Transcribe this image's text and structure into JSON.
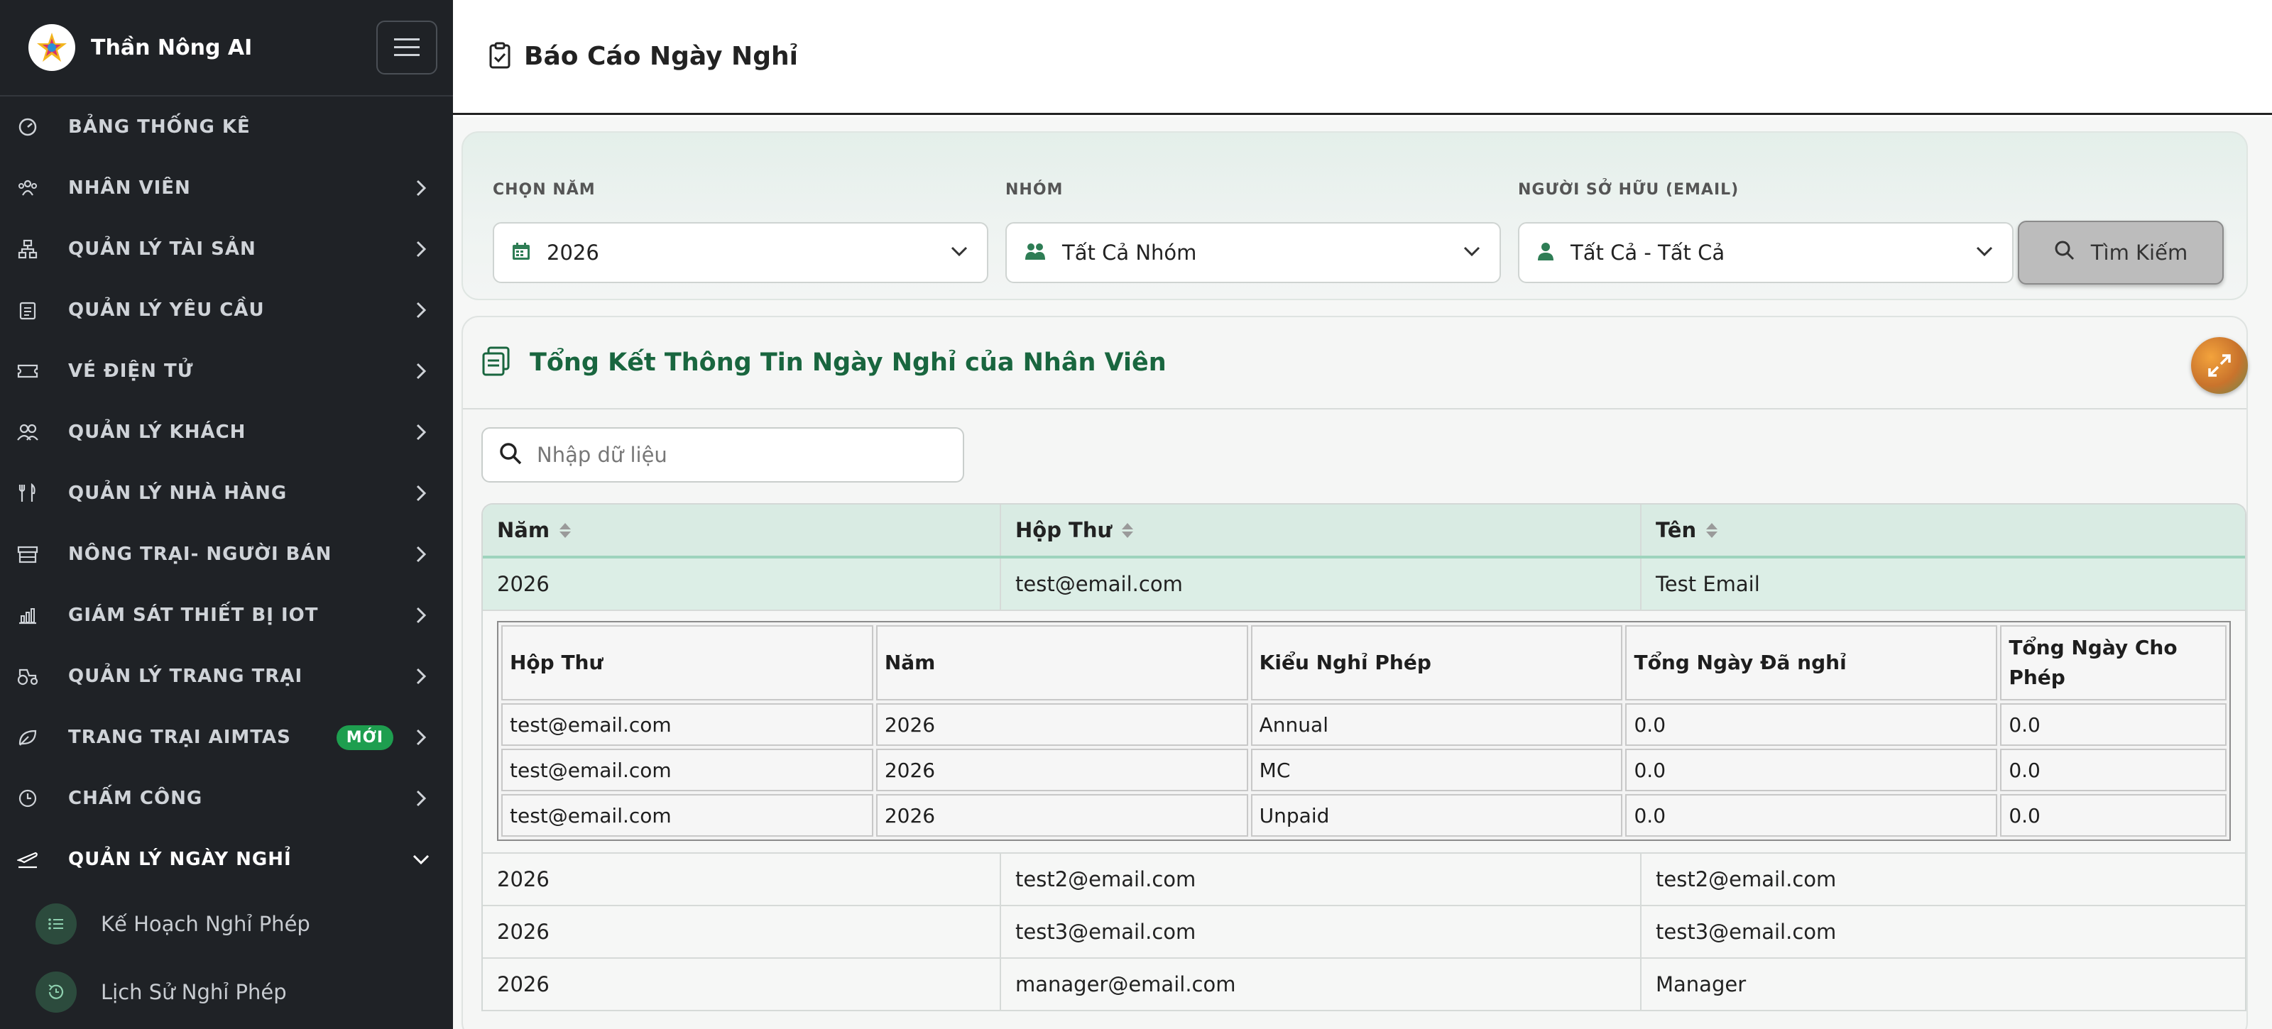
{
  "app": {
    "brand_name": "Thần Nông AI"
  },
  "sidebar": {
    "items": [
      {
        "key": "dashboard",
        "label": "BẢNG THỐNG KÊ",
        "icon": "gauge-icon",
        "chevron": false
      },
      {
        "key": "employees",
        "label": "NHÂN VIÊN",
        "icon": "people-icon",
        "chevron": true
      },
      {
        "key": "assets",
        "label": "QUẢN LÝ TÀI SẢN",
        "icon": "sitemap-icon",
        "chevron": true
      },
      {
        "key": "requests",
        "label": "QUẢN LÝ YÊU CẦU",
        "icon": "clipboard-icon",
        "chevron": true
      },
      {
        "key": "tickets",
        "label": "VÉ ĐIỆN TỬ",
        "icon": "ticket-icon",
        "chevron": true
      },
      {
        "key": "customers",
        "label": "QUẢN LÝ KHÁCH",
        "icon": "users-icon",
        "chevron": true
      },
      {
        "key": "restaurant",
        "label": "QUẢN LÝ NHÀ HÀNG",
        "icon": "utensils-icon",
        "chevron": true
      },
      {
        "key": "farm-sellers",
        "label": "NÔNG TRẠI- NGƯỜI BÁN",
        "icon": "store-icon",
        "chevron": true
      },
      {
        "key": "iot",
        "label": "GIÁM SÁT THIẾT BỊ IOT",
        "icon": "chart-icon",
        "chevron": true
      },
      {
        "key": "farm",
        "label": "QUẢN LÝ TRANG TRẠI",
        "icon": "tractor-icon",
        "chevron": true
      },
      {
        "key": "aimtas",
        "label": "TRANG TRẠI AIMTAS",
        "icon": "leaf-icon",
        "chevron": true,
        "badge": "MỚI"
      },
      {
        "key": "timekeeping",
        "label": "CHẤM CÔNG",
        "icon": "clock-icon",
        "chevron": true
      },
      {
        "key": "leave",
        "label": "QUẢN LÝ NGÀY NGHỈ",
        "icon": "plane-icon",
        "chevron": true,
        "open": true
      }
    ],
    "sub_items": [
      {
        "label": "Kế Hoạch Nghỉ Phép",
        "icon": "list-icon"
      },
      {
        "label": "Lịch Sử Nghỉ Phép",
        "icon": "history-icon"
      }
    ]
  },
  "header": {
    "title": "Báo Cáo Ngày Nghỉ"
  },
  "filters": {
    "year_label": "CHỌN NĂM",
    "year_value": "2026",
    "group_label": "NHÓM",
    "group_value": "Tất Cả Nhóm",
    "owner_label": "NGƯỜI SỞ HỮU (EMAIL)",
    "owner_value": "Tất Cả - Tất Cả",
    "search_button": "Tìm Kiếm"
  },
  "summary": {
    "title": "Tổng Kết Thông Tin Ngày Nghỉ của Nhân Viên",
    "search_placeholder": "Nhập dữ liệu",
    "columns": [
      "Năm",
      "Hộp Thư",
      "Tên"
    ],
    "rows": [
      {
        "year": "2026",
        "email": "test@email.com",
        "name": "Test Email"
      },
      {
        "year": "2026",
        "email": "test2@email.com",
        "name": "test2@email.com"
      },
      {
        "year": "2026",
        "email": "test3@email.com",
        "name": "test3@email.com"
      },
      {
        "year": "2026",
        "email": "manager@email.com",
        "name": "Manager"
      }
    ],
    "detail": {
      "columns": [
        "Hộp Thư",
        "Năm",
        "Kiểu Nghỉ Phép",
        "Tổng Ngày Đã nghỉ",
        "Tổng Ngày Cho Phép"
      ],
      "rows": [
        {
          "email": "test@email.com",
          "year": "2026",
          "type": "Annual",
          "taken": "0.0",
          "allowed": "0.0"
        },
        {
          "email": "test@email.com",
          "year": "2026",
          "type": "MC",
          "taken": "0.0",
          "allowed": "0.0"
        },
        {
          "email": "test@email.com",
          "year": "2026",
          "type": "Unpaid",
          "taken": "0.0",
          "allowed": "0.0"
        }
      ]
    }
  },
  "colors": {
    "sidebar_bg": "#1f2226",
    "accent_green": "#19663f",
    "badge_green": "#1e9e4f",
    "header_row_bg": "#d9ebe3"
  }
}
